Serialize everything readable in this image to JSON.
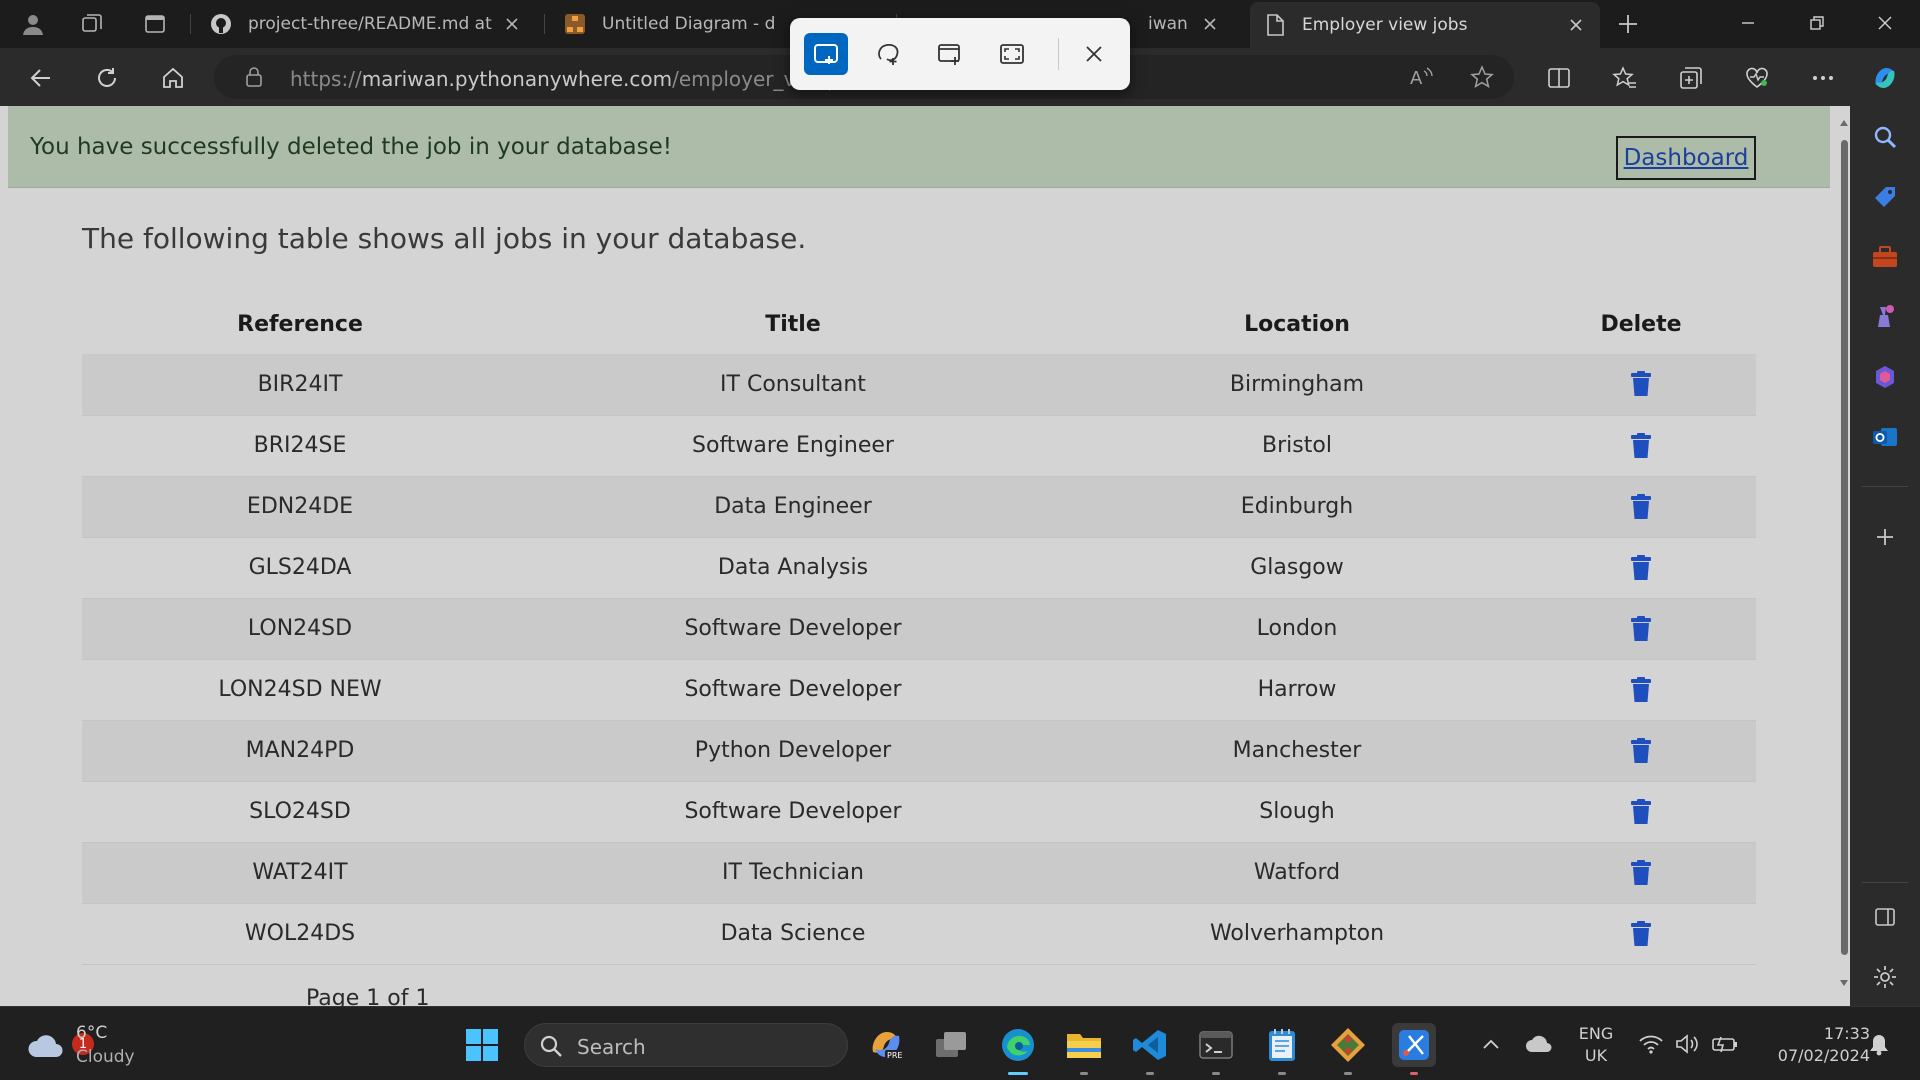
{
  "browser": {
    "tabs": [
      {
        "title": "project-three/README.md at m",
        "icon": "github-icon"
      },
      {
        "title": "Untitled Diagram - draw",
        "icon": "drawio-icon"
      },
      {
        "title": "iwan - Ou",
        "icon": "outlook-icon"
      },
      {
        "title": "Employer view jobs",
        "icon": "page-icon",
        "active": true
      }
    ],
    "url": {
      "scheme": "https://",
      "host": "mariwan.pythonanywhere.com",
      "path": "/employer_view_"
    }
  },
  "alert": {
    "message": "You have successfully deleted the job in your database!",
    "dashboard_label": "Dashboard"
  },
  "page": {
    "intro": "The following table shows all jobs in your database.",
    "pager": "Page 1 of 1"
  },
  "table": {
    "headers": [
      "Reference",
      "Title",
      "Location",
      "Delete"
    ],
    "rows": [
      {
        "ref": "BIR24IT",
        "title": "IT Consultant",
        "location": "Birmingham"
      },
      {
        "ref": "BRI24SE",
        "title": "Software Engineer",
        "location": "Bristol"
      },
      {
        "ref": "EDN24DE",
        "title": "Data Engineer",
        "location": "Edinburgh"
      },
      {
        "ref": "GLS24DA",
        "title": "Data Analysis",
        "location": "Glasgow"
      },
      {
        "ref": "LON24SD",
        "title": "Software Developer",
        "location": "London"
      },
      {
        "ref": "LON24SD NEW",
        "title": "Software Developer",
        "location": "Harrow"
      },
      {
        "ref": "MAN24PD",
        "title": "Python Developer",
        "location": "Manchester"
      },
      {
        "ref": "SLO24SD",
        "title": "Software Developer",
        "location": "Slough"
      },
      {
        "ref": "WAT24IT",
        "title": "IT Technician",
        "location": "Watford"
      },
      {
        "ref": "WOL24DS",
        "title": "Data Science",
        "location": "Wolverhampton"
      }
    ]
  },
  "taskbar": {
    "weather": {
      "temp": "6°C",
      "condition": "Cloudy",
      "badge": "1"
    },
    "search_label": "Search",
    "lang": {
      "line1": "ENG",
      "line2": "UK"
    },
    "time": "17:33",
    "date": "07/02/2024"
  },
  "colors": {
    "accent": "#0067c0",
    "trash": "#1f4fbf",
    "alert_bg": "#adbca9",
    "link": "#1a3f9c"
  }
}
